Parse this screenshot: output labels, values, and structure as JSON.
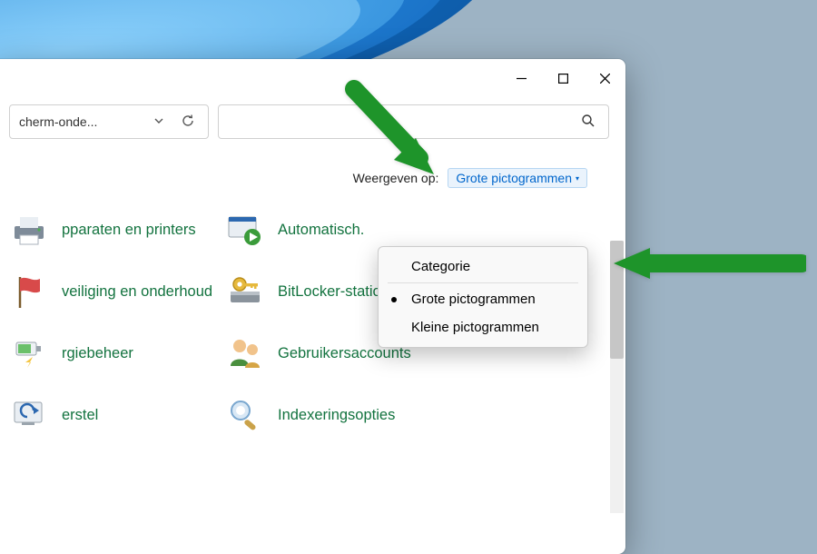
{
  "addressbar": {
    "crumb": "cherm-onde..."
  },
  "viewby": {
    "label": "Weergeven op:",
    "current": "Grote pictogrammen"
  },
  "dropdown": {
    "items": [
      {
        "label": "Categorie",
        "selected": false
      },
      {
        "label": "Grote pictogrammen",
        "selected": true
      },
      {
        "label": "Kleine pictogrammen",
        "selected": false
      }
    ]
  },
  "items_left": [
    "pparaten en printers",
    "veiliging en onderhoud",
    "rgiebeheer",
    "erstel"
  ],
  "items_right": [
    "Automatisch.",
    "BitLocker-stationsversle...",
    "Gebruikersaccounts",
    "Indexeringsopties"
  ]
}
